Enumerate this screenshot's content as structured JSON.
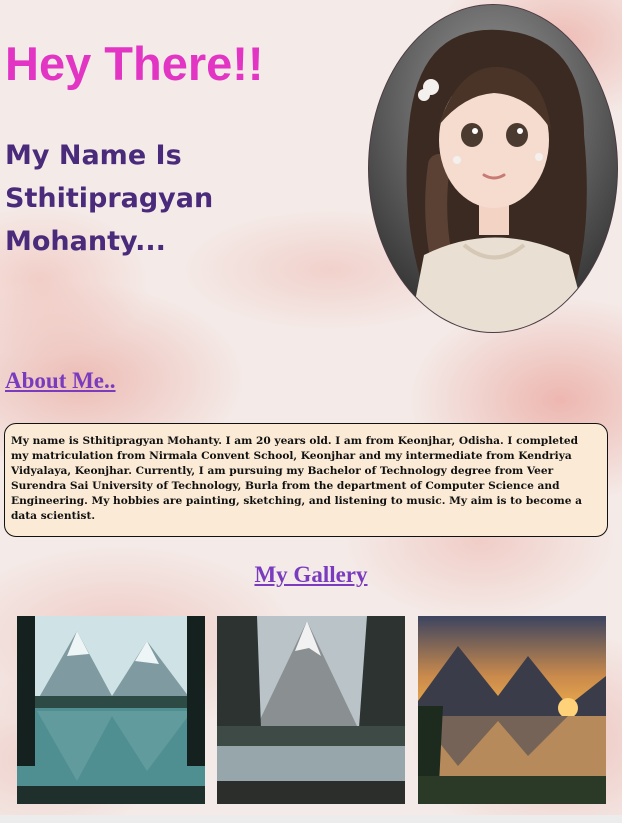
{
  "hero": {
    "greeting": "Hey There!!",
    "intro": "My Name Is Sthitipragyan Mohanty...",
    "avatar_icon": "girl-portrait-avatar"
  },
  "about": {
    "title": "About Me..",
    "text": "My name is Sthitipragyan Mohanty. I am 20 years old. I am from Keonjhar, Odisha. I completed my matriculation from Nirmala Convent School, Keonjhar and my intermediate from Kendriya Vidyalaya, Keonjhar. Currently, I am pursuing my Bachelor of Technology degree from Veer Surendra Sai University of Technology, Burla from the department of Computer Science and Engineering. My hobbies are painting, sketching, and listening to music. My aim is to become a data scientist."
  },
  "gallery": {
    "title": "My Gallery",
    "images": [
      {
        "icon": "mountain-lake-forest-landscape"
      },
      {
        "icon": "mountain-peak-river-landscape"
      },
      {
        "icon": "mountain-sunset-lake-landscape"
      }
    ]
  },
  "colors": {
    "greeting": "#e235c4",
    "intro": "#4a2a7a",
    "headings": "#7a3bbf",
    "about_box": "#fbebd6"
  }
}
